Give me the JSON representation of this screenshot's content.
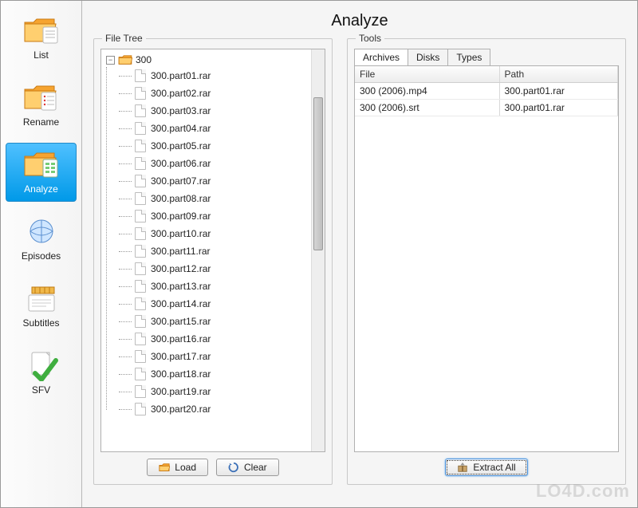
{
  "title": "Analyze",
  "sidebar": {
    "items": [
      {
        "id": "list",
        "label": "List",
        "selected": false
      },
      {
        "id": "rename",
        "label": "Rename",
        "selected": false
      },
      {
        "id": "analyze",
        "label": "Analyze",
        "selected": true
      },
      {
        "id": "episodes",
        "label": "Episodes",
        "selected": false
      },
      {
        "id": "subtitles",
        "label": "Subtitles",
        "selected": false
      },
      {
        "id": "sfv",
        "label": "SFV",
        "selected": false
      }
    ]
  },
  "filetree": {
    "legend": "File Tree",
    "root": {
      "name": "300",
      "expanded": true
    },
    "children": [
      "300.part01.rar",
      "300.part02.rar",
      "300.part03.rar",
      "300.part04.rar",
      "300.part05.rar",
      "300.part06.rar",
      "300.part07.rar",
      "300.part08.rar",
      "300.part09.rar",
      "300.part10.rar",
      "300.part11.rar",
      "300.part12.rar",
      "300.part13.rar",
      "300.part14.rar",
      "300.part15.rar",
      "300.part16.rar",
      "300.part17.rar",
      "300.part18.rar",
      "300.part19.rar",
      "300.part20.rar"
    ],
    "buttons": {
      "load": "Load",
      "clear": "Clear"
    }
  },
  "tools": {
    "legend": "Tools",
    "tabs": [
      "Archives",
      "Disks",
      "Types"
    ],
    "active_tab": 0,
    "columns": [
      "File",
      "Path"
    ],
    "rows": [
      {
        "file": "300 (2006).mp4",
        "path": "300.part01.rar"
      },
      {
        "file": "300 (2006).srt",
        "path": "300.part01.rar"
      }
    ],
    "extract_label": "Extract All"
  },
  "watermark": "LO4D.com"
}
